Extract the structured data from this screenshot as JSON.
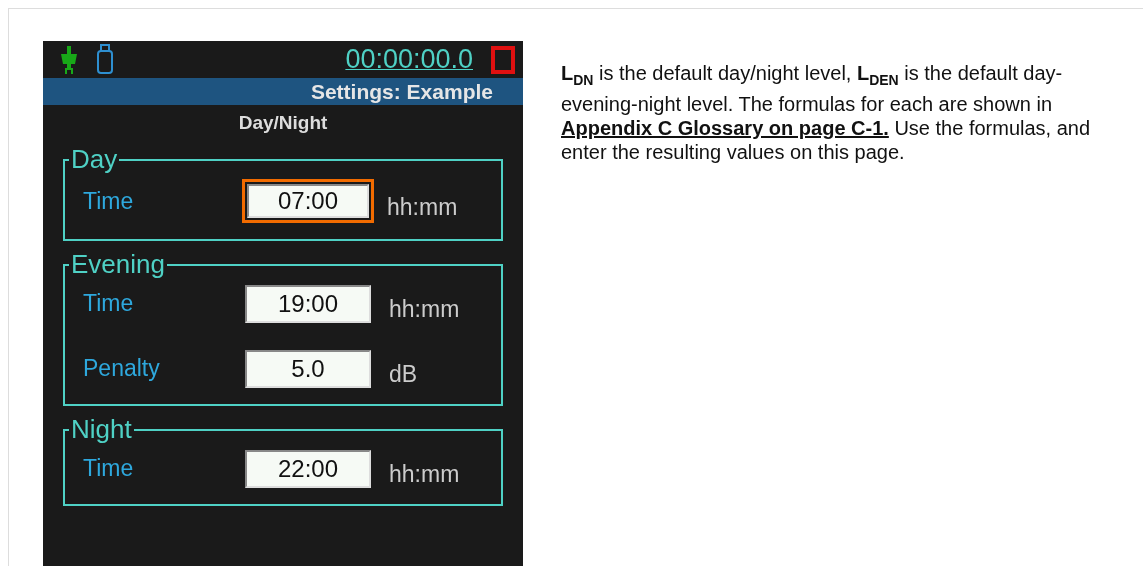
{
  "device": {
    "time": "00:00:00.0",
    "header": "Settings: Example",
    "screen_title": "Day/Night",
    "groups": [
      {
        "title": "Day",
        "rows": [
          {
            "label": "Time",
            "value": "07:00",
            "unit": "hh:mm",
            "focused": true
          }
        ]
      },
      {
        "title": "Evening",
        "rows": [
          {
            "label": "Time",
            "value": "19:00",
            "unit": "hh:mm",
            "focused": false
          },
          {
            "label": "Penalty",
            "value": "5.0",
            "unit": "dB",
            "focused": false
          }
        ]
      },
      {
        "title": "Night",
        "rows": [
          {
            "label": "Time",
            "value": "22:00",
            "unit": "hh:mm",
            "focused": false
          }
        ]
      }
    ]
  },
  "description": {
    "before": "**L**$_{DN}$ is the default day/night level, **L**$_{DEN}$ is the default day-evening-night level. The formulas for each are shown in",
    "link": "Appendix C   Glossary on page C-1.",
    "after": "Use the formulas, and enter the resulting values on this page."
  }
}
